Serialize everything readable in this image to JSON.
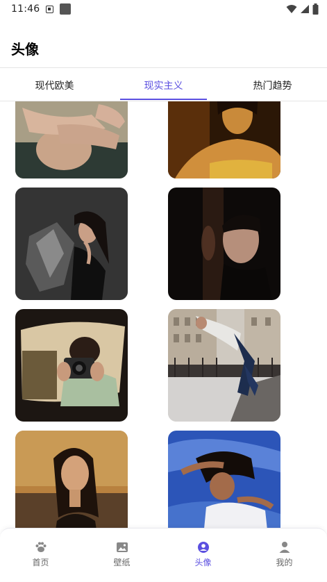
{
  "status_bar": {
    "time": "11:46"
  },
  "header": {
    "title": "头像"
  },
  "tabs": [
    {
      "label": "现代欧美",
      "active": false
    },
    {
      "label": "现实主义",
      "active": true
    },
    {
      "label": "热门趋势",
      "active": false
    }
  ],
  "photos": [
    {
      "icon": "hands-over-face-photo"
    },
    {
      "icon": "woman-orange-light-photo"
    },
    {
      "icon": "woman-black-feathers-photo"
    },
    {
      "icon": "man-dark-profile-photo"
    },
    {
      "icon": "camera-in-mirror-photo"
    },
    {
      "icon": "skateboard-street-photo"
    },
    {
      "icon": "woman-warm-portrait-photo"
    },
    {
      "icon": "woman-blue-sheets-photo"
    }
  ],
  "bottom_nav": {
    "items": [
      {
        "label": "首页",
        "icon": "paw-icon",
        "active": false
      },
      {
        "label": "壁纸",
        "icon": "image-icon",
        "active": false
      },
      {
        "label": "头像",
        "icon": "user-circle-icon",
        "active": true
      },
      {
        "label": "我的",
        "icon": "person-icon",
        "active": false
      }
    ]
  },
  "colors": {
    "accent": "#5b4fe0",
    "nav_inactive": "#888888",
    "divider": "#e4e4e4"
  }
}
